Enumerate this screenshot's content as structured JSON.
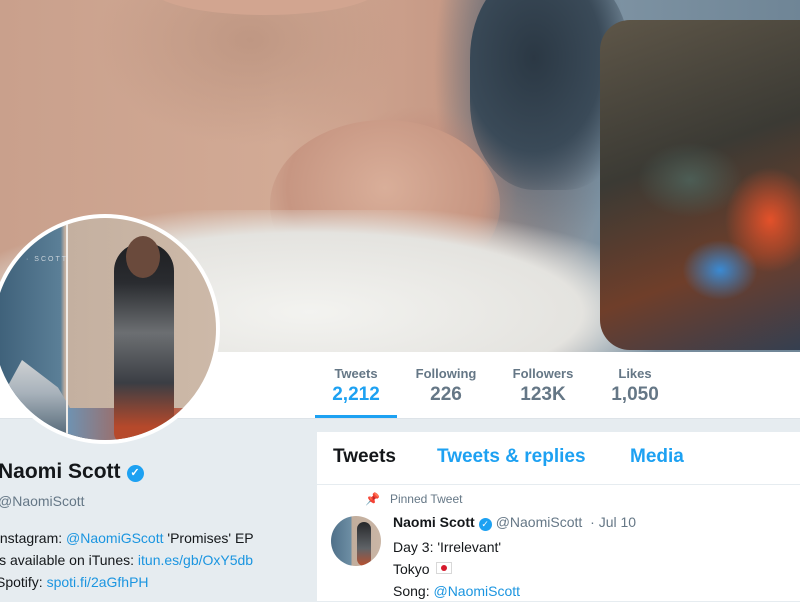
{
  "stats": [
    {
      "label": "Tweets",
      "value": "2,212",
      "active": true
    },
    {
      "label": "Following",
      "value": "226",
      "active": false
    },
    {
      "label": "Followers",
      "value": "123K",
      "active": false
    },
    {
      "label": "Likes",
      "value": "1,050",
      "active": false
    }
  ],
  "profile": {
    "name": "Naomi Scott",
    "verified_icon": "verified-badge-icon",
    "handle": "@NaomiScott",
    "bio": {
      "line1_prefix": "Instagram: ",
      "line1_link": "@NaomiGScott",
      "line1_suffix": " 'Promises' EP",
      "line2_prefix": "is available on iTunes: ",
      "line2_link": "itun.es/gb/OxY5db",
      "line3_prefix": "Spotify: ",
      "line3_link": "spoti.fi/2aGfhPH"
    }
  },
  "tabs": [
    {
      "label": "Tweets",
      "active": true
    },
    {
      "label": "Tweets & replies",
      "active": false
    },
    {
      "label": "Media",
      "active": false
    }
  ],
  "pinned_tweet": {
    "pinned_label": "Pinned Tweet",
    "author_name": "Naomi Scott",
    "author_handle": "@NaomiScott",
    "date": "Jul 10",
    "line1": "Day 3: 'Irrelevant'",
    "line2": "Tokyo",
    "line3_prefix": "Song: ",
    "line3_link": "@NaomiScott"
  },
  "colors": {
    "accent": "#1da1f2",
    "link": "#1b95e0",
    "background": "#e6ecf0",
    "text_primary": "#14171a",
    "text_secondary": "#657786"
  }
}
